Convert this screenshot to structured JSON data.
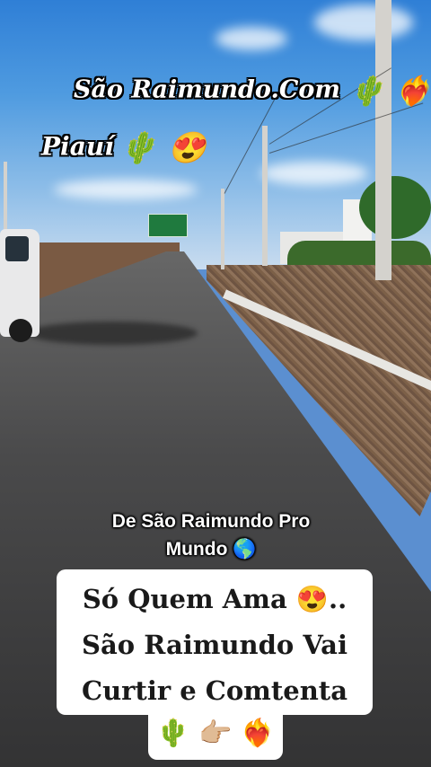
{
  "overlay": {
    "title": "São Raimundo.Com",
    "title_emojis": "🌵 ❤️‍🔥",
    "region": "Piauí",
    "region_emojis": "🌵 😍",
    "subtitle": "De São Raimundo Pro Mundo 🌎",
    "caption_lines": [
      "Só Quem Ama 😍..",
      "São Raimundo Vai",
      "Curtir e Comtenta"
    ],
    "caption_emojis": "🌵 👉🏼 ❤️‍🔥"
  },
  "colors": {
    "sky": "#4f9be0",
    "road": "#3b3b3c",
    "gravel": "#7c6048",
    "card": "#ffffff"
  }
}
